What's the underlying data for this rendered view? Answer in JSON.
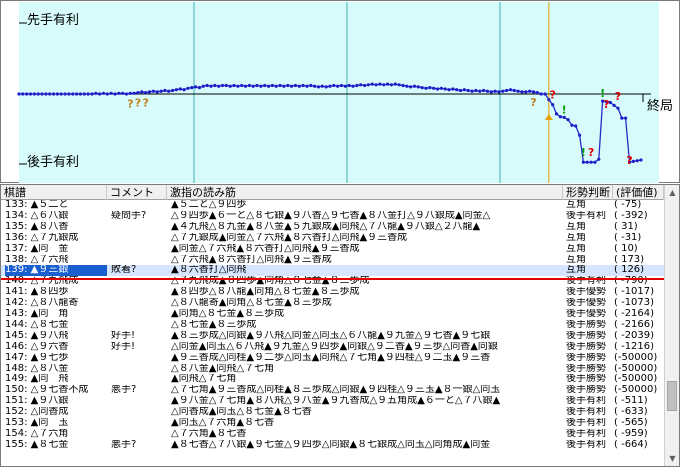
{
  "graph": {
    "label_sente": "先手有利",
    "label_gote": "後手有利",
    "label_end": "終局",
    "colors": {
      "zone": "#d7fbfb",
      "line": "#2a2ac8",
      "dot": "#1e1ec8",
      "marker_gote": "#00a000",
      "marker_bad": "#e00000",
      "marker_doubt": "#c08020",
      "cursor": "#e8a000",
      "axis": "#000000",
      "grid": "#40b0b0"
    },
    "chart_data": {
      "type": "line",
      "x_range": [
        1,
        163
      ],
      "y_range": [
        -1,
        1
      ],
      "series": [
        {
          "values": [
            0.0,
            0.0,
            0.0,
            0.0,
            0.0,
            0.0,
            0.0,
            0.0,
            0.0,
            0.0,
            0.0,
            0.0,
            0.0,
            0.0,
            0.0,
            0.0,
            0.0,
            0.0,
            0.0,
            0.0,
            0.01,
            0.0,
            0.01,
            0.0,
            0.01,
            0.0,
            0.01,
            0.01,
            0.0,
            0.01,
            0.01,
            0.02,
            0.03,
            0.02,
            0.03,
            0.04,
            0.03,
            0.04,
            0.05,
            0.04,
            0.05,
            0.06,
            0.07,
            0.06,
            0.08,
            0.09,
            0.1,
            0.09,
            0.11,
            0.12,
            0.11,
            0.12,
            0.11,
            0.12,
            0.12,
            0.11,
            0.12,
            0.11,
            0.12,
            0.11,
            0.12,
            0.11,
            0.12,
            0.11,
            0.12,
            0.11,
            0.12,
            0.11,
            0.12,
            0.11,
            0.12,
            0.11,
            0.12,
            0.11,
            0.12,
            0.11,
            0.12,
            0.11,
            0.1,
            0.11,
            0.1,
            0.11,
            0.12,
            0.11,
            0.12,
            0.11,
            0.12,
            0.11,
            0.12,
            0.13,
            0.12,
            0.13,
            0.14,
            0.13,
            0.14,
            0.13,
            0.14,
            0.13,
            0.14,
            0.13,
            0.12,
            0.11,
            0.1,
            0.11,
            0.1,
            0.09,
            0.08,
            0.09,
            0.08,
            0.07,
            0.08,
            0.07,
            0.06,
            0.07,
            0.06,
            0.05,
            0.06,
            0.05,
            0.04,
            0.05,
            0.04,
            0.05,
            0.04,
            0.03,
            0.04,
            0.03,
            0.04,
            0.05,
            0.06,
            0.05,
            0.04,
            0.03,
            0.03,
            0.04,
            0.03,
            0.02,
            0.0,
            0.0,
            -0.08,
            -0.15,
            -0.28,
            -0.32,
            -0.33,
            -0.36,
            -0.44,
            -0.45,
            -0.58,
            -0.96,
            -0.96,
            -0.96,
            -0.96,
            -0.92,
            -0.1,
            -0.11,
            -0.12,
            -0.16,
            -0.2,
            -0.34,
            -0.34,
            -0.96,
            -0.95,
            -0.94,
            -0.93
          ]
        }
      ]
    }
  },
  "list": {
    "columns": [
      "棋譜",
      "コメント",
      "激指の読み筋",
      "形勢判断",
      "(評価値)"
    ],
    "selected_index": 6,
    "rows": [
      {
        "move": "133: ▲５二と",
        "comment": "",
        "reading": "▲５二と△９四歩",
        "judgment": "互角",
        "eval": "(    -75)"
      },
      {
        "move": "134: △６八銀",
        "comment": "疑問手?",
        "reading": "△９四歩▲６一と△８七銀▲９八香△９七香▲８八金打△９八銀成▲同金△",
        "judgment": "後手有利",
        "eval": "(  -392)"
      },
      {
        "move": "135: ▲８八香",
        "comment": "",
        "reading": "▲４九飛△８九金▲８八金▲５九銀成▲同飛△７八龍▲９八銀△２八龍▲",
        "judgment": "互角",
        "eval": "(     31)"
      },
      {
        "move": "136: △７九銀成",
        "comment": "",
        "reading": "△７九銀成▲同金△７六飛▲８六香打△同飛▲９三香成",
        "judgment": "互角",
        "eval": "(    -31)"
      },
      {
        "move": "137: ▲同　金",
        "comment": "",
        "reading": "▲同金△７六飛▲８六香打△同飛▲９三香成",
        "judgment": "互角",
        "eval": "(     10)"
      },
      {
        "move": "138: △７六飛",
        "comment": "",
        "reading": "△７六飛▲８六香打△同飛▲９三香成",
        "judgment": "互角",
        "eval": "(   173)"
      },
      {
        "move": "139: ▲９三銀",
        "comment": "敗着?",
        "reading": "▲８六香打△同飛",
        "judgment": "互角",
        "eval": "(   126)"
      },
      {
        "move": "140: △７九飛成",
        "comment": "",
        "reading": "△７九飛成▲８四歩▲同角△８七金▲８三歩成",
        "judgment": "後手有利",
        "eval": "(  -790)"
      },
      {
        "move": "141: ▲８四歩",
        "comment": "",
        "reading": "▲８四歩△８八龍▲同角△８七金▲８三歩成",
        "judgment": "後手優勢",
        "eval": "( -1017)"
      },
      {
        "move": "142: △８八龍寄",
        "comment": "",
        "reading": "△８八龍寄▲同角△８七金▲８三歩成",
        "judgment": "後手優勢",
        "eval": "( -1073)"
      },
      {
        "move": "143: ▲同　角",
        "comment": "",
        "reading": "▲同角△８七金▲８三歩成",
        "judgment": "後手優勢",
        "eval": "( -2164)"
      },
      {
        "move": "144: △８七金",
        "comment": "",
        "reading": "△８七金▲８三歩成",
        "judgment": "後手勝勢",
        "eval": "( -2166)"
      },
      {
        "move": "145: ▲９八飛",
        "comment": "好手!",
        "reading": "▲８三歩成△同銀▲９八飛△同金△同玉△６八龍▲９九金△９七香▲９七銀",
        "judgment": "後手勝勢",
        "eval": "( -2039)"
      },
      {
        "move": "146: △９六香",
        "comment": "好手!",
        "reading": "△同金▲同玉△６八飛▲９九金△９四歩▲同銀△９二香▲９三歩△同香▲同銀",
        "judgment": "後手勝勢",
        "eval": "( -1216)"
      },
      {
        "move": "147: ▲９七歩",
        "comment": "",
        "reading": "▲９三香成△同桂▲９二歩△同玉▲同飛△７七角▲９四桂△９二玉▲９三香",
        "judgment": "後手勝勢",
        "eval": "(-50000)"
      },
      {
        "move": "148: △８八金",
        "comment": "",
        "reading": "△８八金▲同飛△７七角",
        "judgment": "後手勝勢",
        "eval": "(-50000)"
      },
      {
        "move": "149: ▲同　飛",
        "comment": "",
        "reading": "▲同飛△７七角",
        "judgment": "後手勝勢",
        "eval": "(-50000)"
      },
      {
        "move": "150: △９七香不成",
        "comment": "悪手?",
        "reading": "△７七角▲９三香成△同桂▲８三歩成△同銀▲９四桂△９三玉▲８一銀△同玉",
        "judgment": "後手勝勢",
        "eval": "(-50000)"
      },
      {
        "move": "151: ▲９八銀",
        "comment": "",
        "reading": "▲９八金△７七角▲８八飛△９八金▲９九香成△９五角成▲６一と△７八銀▲",
        "judgment": "後手有利",
        "eval": "(  -511)"
      },
      {
        "move": "152: △同香成",
        "comment": "",
        "reading": "△同香成▲同玉△８七金▲８七香",
        "judgment": "後手有利",
        "eval": "(  -633)"
      },
      {
        "move": "153: ▲同　玉",
        "comment": "",
        "reading": "▲同玉△７六角▲８七香",
        "judgment": "後手有利",
        "eval": "(  -565)"
      },
      {
        "move": "154: △７六角",
        "comment": "",
        "reading": "△７六角▲８七香",
        "judgment": "後手有利",
        "eval": "(  -959)"
      },
      {
        "move": "155: ▲８七金",
        "comment": "悪手?",
        "reading": "▲８七香△７八銀▲９七金△９四歩△同銀▲８七銀成△同玉△同角成▲同金",
        "judgment": "後手有利",
        "eval": "(  -664)"
      }
    ]
  }
}
